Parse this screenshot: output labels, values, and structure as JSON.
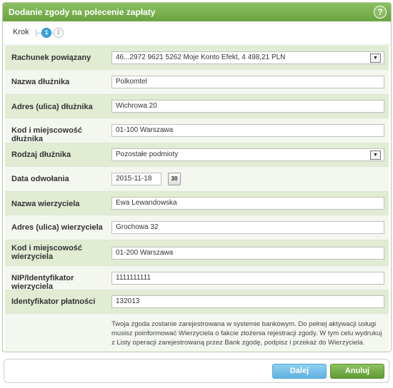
{
  "window": {
    "title": "Dodanie zgody na polecenie zapłaty",
    "help_icon": "?"
  },
  "steps": {
    "label": "Krok",
    "step1": "1",
    "step2": "2"
  },
  "form": {
    "rachunek": {
      "label": "Rachunek powiązany",
      "value": "46...2972 9621 5262 Moje Konto Efekt, 4 498,21 PLN"
    },
    "nazwa_dluznika": {
      "label": "Nazwa dłużnika",
      "value": "Polkomtel"
    },
    "adres_dluznika": {
      "label": "Adres (ulica) dłużnika",
      "value": "Wichrowa 20"
    },
    "kod_dluznika": {
      "label": "Kod i miejscowość dłużnika",
      "value": "01-100 Warszawa"
    },
    "rodzaj_dluznika": {
      "label": "Rodzaj dłużnika",
      "value": "Pozostałe podmioty"
    },
    "data_odwolania": {
      "label": "Data odwołania",
      "value": "2015-11-18",
      "calendar_text": "30"
    },
    "nazwa_wierzyciela": {
      "label": "Nazwa wierzyciela",
      "value": "Ewa Lewandowska"
    },
    "adres_wierzyciela": {
      "label": "Adres (ulica) wierzyciela",
      "value": "Grochowa 32"
    },
    "kod_wierzyciela": {
      "label": "Kod i miejscowość wierzyciela",
      "value": "01-200 Warszawa"
    },
    "nip_wierzyciela": {
      "label": "NIP/Identyfikator wierzyciela",
      "value": "1111111111"
    },
    "identyfikator": {
      "label": "Identyfikator płatności",
      "value": "132013"
    },
    "info": "Twoja zgoda zostanie zarejestrowana w systemie bankowym. Do pełnej aktywacji usługi musisz poinformować Wierzyciela o fakcie złożenia rejestracji zgody. W tym celu wydrukuj z Listy operacji zarejestrowaną przez Bank zgodę, podpisz i przekaż do Wierzyciela."
  },
  "buttons": {
    "next": "Dalej",
    "cancel": "Anuluj"
  },
  "colors": {
    "title_bar": "#6aa23f",
    "row_odd": "#e1ecd3",
    "row_even": "#f4f7f0",
    "next_button": "#5fb2e0",
    "cancel_button": "#5f9a33"
  }
}
